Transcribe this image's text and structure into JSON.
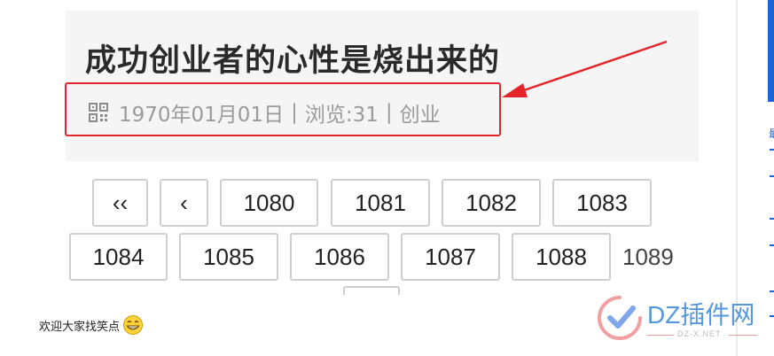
{
  "article": {
    "title": "成功创业者的心性是烧出来的",
    "date": "1970年01月01日",
    "separator": "|",
    "views": "浏览:31",
    "category": "创业"
  },
  "pagination": {
    "first_label": "‹‹",
    "prev_label": "‹",
    "pages": [
      "1080",
      "1081",
      "1082",
      "1083",
      "1084",
      "1085",
      "1086",
      "1087",
      "1088"
    ],
    "current": "1089"
  },
  "footer": {
    "text": "欢迎大家找笑点"
  },
  "sidebar": {
    "partial_char": "最"
  },
  "watermark": {
    "brand": "DZ插件网",
    "site": "DZ-X.NET"
  },
  "colors": {
    "highlight": "#e5232b",
    "accent": "#1c63d6",
    "meta_text": "#9a9a9a"
  },
  "icons": {
    "meta": "qr-code-icon",
    "footer": "grinning-face-icon"
  }
}
